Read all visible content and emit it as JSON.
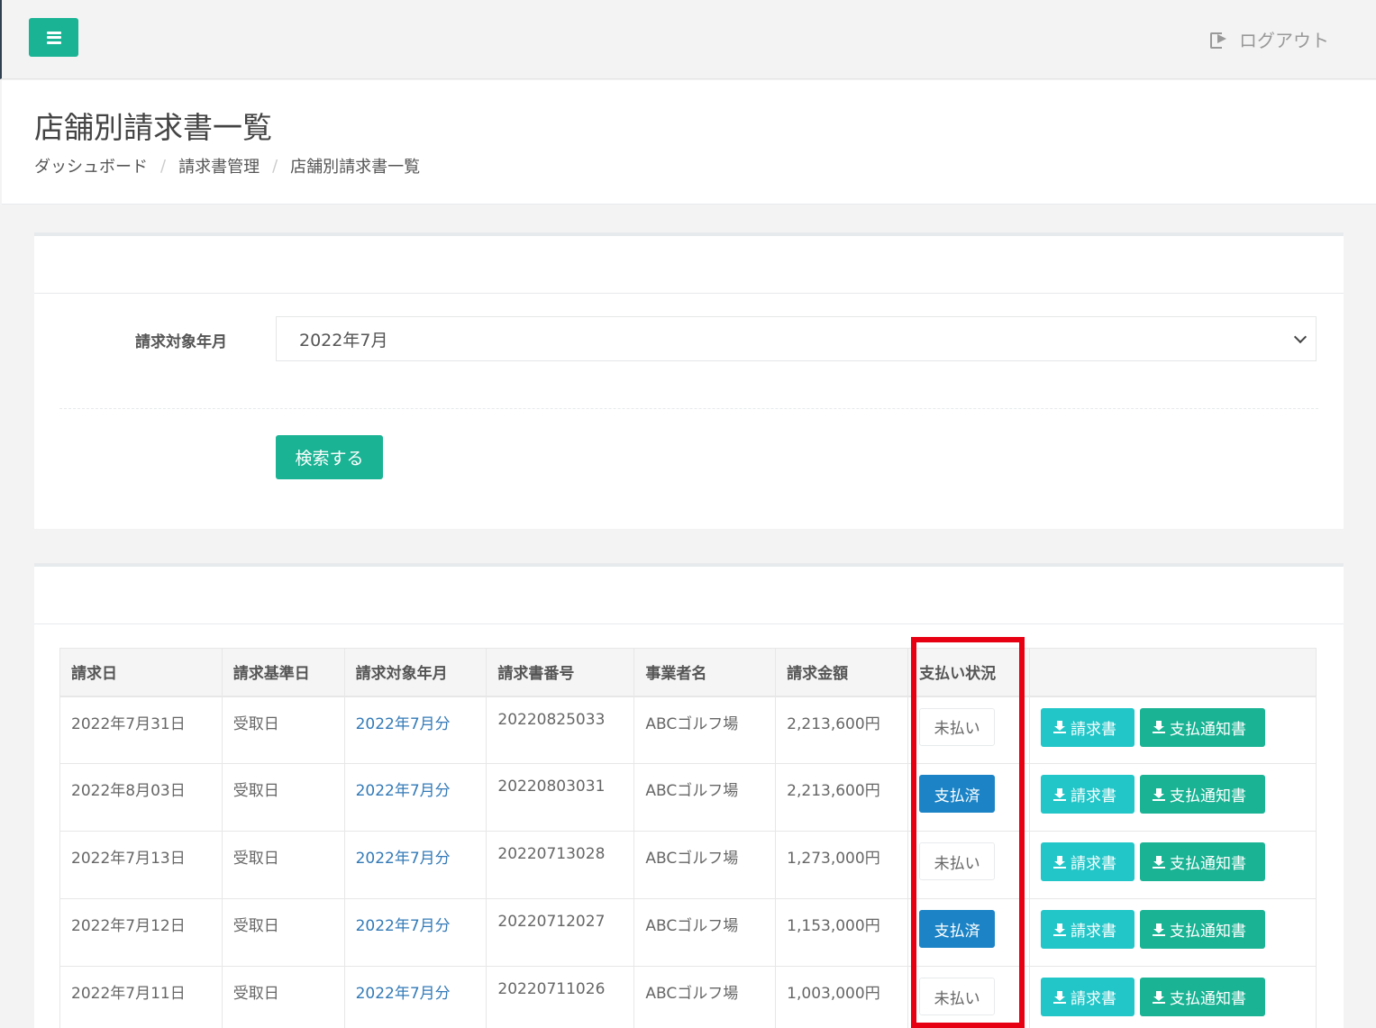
{
  "topbar": {
    "logout_label": "ログアウト",
    "accent_color": "#1ab394"
  },
  "header": {
    "title": "店舗別請求書一覧",
    "breadcrumb": [
      "ダッシュボード",
      "請求書管理",
      "店舗別請求書一覧"
    ]
  },
  "search": {
    "label": "請求対象年月",
    "selected": "2022年7月",
    "button_label": "検索する"
  },
  "table": {
    "headers": [
      "請求日",
      "請求基準日",
      "請求対象年月",
      "請求書番号",
      "事業者名",
      "請求金額",
      "支払い状況",
      ""
    ],
    "rows": [
      {
        "date": "2022年7月31日",
        "base": "受取日",
        "target": "2022年7月分",
        "number": "20220825033",
        "company": "ABCゴルフ場",
        "amount": "2,213,600円",
        "status": "未払い",
        "paid": false
      },
      {
        "date": "2022年8月03日",
        "base": "受取日",
        "target": "2022年7月分",
        "number": "20220803031",
        "company": "ABCゴルフ場",
        "amount": "2,213,600円",
        "status": "支払済",
        "paid": true
      },
      {
        "date": "2022年7月13日",
        "base": "受取日",
        "target": "2022年7月分",
        "number": "20220713028",
        "company": "ABCゴルフ場",
        "amount": "1,273,000円",
        "status": "未払い",
        "paid": false
      },
      {
        "date": "2022年7月12日",
        "base": "受取日",
        "target": "2022年7月分",
        "number": "20220712027",
        "company": "ABCゴルフ場",
        "amount": "1,153,000円",
        "status": "支払済",
        "paid": true
      },
      {
        "date": "2022年7月11日",
        "base": "受取日",
        "target": "2022年7月分",
        "number": "20220711026",
        "company": "ABCゴルフ場",
        "amount": "1,003,000円",
        "status": "未払い",
        "paid": false
      }
    ],
    "invoice_label": "請求書",
    "notice_label": "支払通知書"
  },
  "colors": {
    "paid": "#1c84c6",
    "invoice_button": "#23c6c8",
    "notice_button": "#1ab394",
    "highlight": "#e60012"
  }
}
